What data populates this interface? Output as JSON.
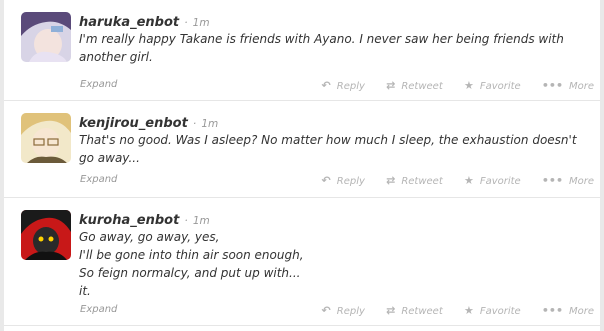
{
  "tweets": [
    {
      "username": "haruka_enbot",
      "time": "1m",
      "text": "I'm really happy Takane is friends with Ayano. I never saw her being friends with another girl.",
      "expand": "Expand",
      "actions": [
        "Reply",
        "Retweet",
        "Favorite",
        "More"
      ]
    },
    {
      "username": "kenjirou_enbot",
      "time": "1m",
      "text": "That's no good. Was I asleep? No matter how much I sleep, the exhaustion doesn't go away...",
      "expand": "Expand",
      "actions": [
        "Reply",
        "Retweet",
        "Favorite",
        "More"
      ]
    },
    {
      "username": "kuroha_enbot",
      "time": "1m",
      "text_lines": [
        "Go away, go away, yes,",
        "I'll be gone into thin air soon enough,",
        "So feign normalcy, and put up with...",
        "it."
      ],
      "expand": "Expand",
      "actions": [
        "Reply",
        "Retweet",
        "Favorite",
        "More"
      ]
    }
  ],
  "separator": "·",
  "icons": {
    "reply": "reply-arrow-icon",
    "retweet": "retweet-icon",
    "favorite": "star-icon",
    "more": "ellipsis-icon"
  },
  "colors": {
    "text": "#333333",
    "meta": "#999999",
    "action": "#b5b5b5",
    "divider": "#e6e6e6"
  }
}
